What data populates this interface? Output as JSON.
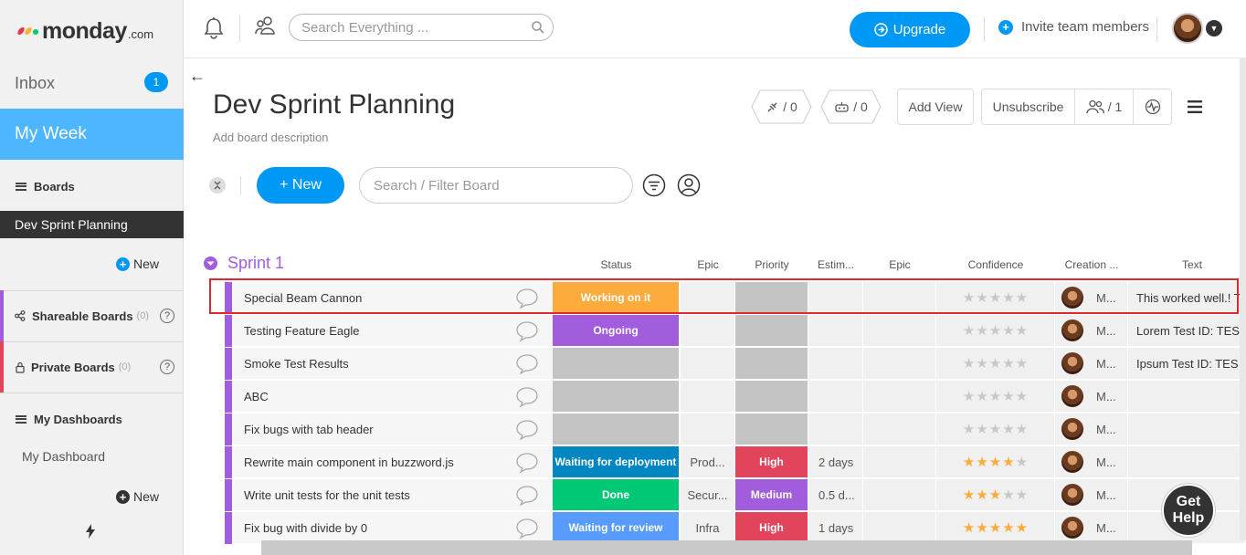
{
  "brand": {
    "name": "monday",
    "suffix": ".com",
    "dot_colors": [
      "#e8364d",
      "#fdb22b",
      "#00c875"
    ]
  },
  "sidebar": {
    "inbox_label": "Inbox",
    "inbox_count": "1",
    "my_week_label": "My Week",
    "boards_label": "Boards",
    "active_board": "Dev Sprint Planning",
    "new_label": "New",
    "shareable_label": "Shareable Boards",
    "shareable_count": "(0)",
    "private_label": "Private Boards",
    "private_count": "(0)",
    "dashboards_label": "My Dashboards",
    "dashboard_item": "My Dashboard",
    "new_label_2": "New",
    "help_q": "?"
  },
  "topbar": {
    "search_placeholder": "Search Everything ...",
    "upgrade_label": "Upgrade",
    "invite_label": "Invite team members"
  },
  "board": {
    "back": "←",
    "title": "Dev Sprint Planning",
    "description": "Add board description",
    "integrations_count": "/ 0",
    "automations_count": "/ 0",
    "add_view": "Add View",
    "unsubscribe": "Unsubscribe",
    "members_count": "/ 1",
    "new_button": "+ New",
    "filter_placeholder": "Search / Filter Board"
  },
  "group": {
    "title": "Sprint 1",
    "color": "#a25ddc",
    "columns": [
      "Status",
      "Epic",
      "Priority",
      "Estim...",
      "Epic",
      "Confidence",
      "Creation ...",
      "Text"
    ]
  },
  "rows": [
    {
      "name": "Special Beam Cannon",
      "status": "Working on it",
      "status_color": "#fdab3d",
      "epic": "",
      "priority": "",
      "priority_color": "#c4c4c4",
      "estimate": "",
      "epic2": "",
      "confidence": 0,
      "creator": "M...",
      "text": "This worked well.! T"
    },
    {
      "name": "Testing Feature Eagle",
      "status": "Ongoing",
      "status_color": "#a25ddc",
      "epic": "",
      "priority": "",
      "priority_color": "#c4c4c4",
      "estimate": "",
      "epic2": "",
      "confidence": 0,
      "creator": "M...",
      "text": "Lorem Test ID: TES"
    },
    {
      "name": "Smoke Test Results",
      "status": "",
      "status_color": "#c4c4c4",
      "epic": "",
      "priority": "",
      "priority_color": "#c4c4c4",
      "estimate": "",
      "epic2": "",
      "confidence": 0,
      "creator": "M...",
      "text": "Ipsum Test ID: TES"
    },
    {
      "name": "ABC",
      "status": "",
      "status_color": "#c4c4c4",
      "epic": "",
      "priority": "",
      "priority_color": "#c4c4c4",
      "estimate": "",
      "epic2": "",
      "confidence": 0,
      "creator": "M...",
      "text": ""
    },
    {
      "name": "Fix bugs with tab header",
      "status": "",
      "status_color": "#c4c4c4",
      "epic": "",
      "priority": "",
      "priority_color": "#c4c4c4",
      "estimate": "",
      "epic2": "",
      "confidence": 0,
      "creator": "M...",
      "text": ""
    },
    {
      "name": "Rewrite main component in buzzword.js",
      "status": "Waiting for deployment",
      "status_color": "#0086c0",
      "epic": "Prod...",
      "priority": "High",
      "priority_color": "#e2445c",
      "estimate": "2 days",
      "epic2": "",
      "confidence": 4,
      "creator": "M...",
      "text": ""
    },
    {
      "name": "Write unit tests for the unit tests",
      "status": "Done",
      "status_color": "#00c875",
      "epic": "Secur...",
      "priority": "Medium",
      "priority_color": "#a25ddc",
      "estimate": "0.5 d...",
      "epic2": "",
      "confidence": 3,
      "creator": "M...",
      "text": ""
    },
    {
      "name": "Fix bug with divide by 0",
      "status": "Waiting for review",
      "status_color": "#579bfc",
      "epic": "Infra",
      "priority": "High",
      "priority_color": "#e2445c",
      "estimate": "1 days",
      "epic2": "",
      "confidence": 5,
      "creator": "M...",
      "text": ""
    }
  ],
  "help": {
    "line1": "Get",
    "line2": "Help"
  }
}
